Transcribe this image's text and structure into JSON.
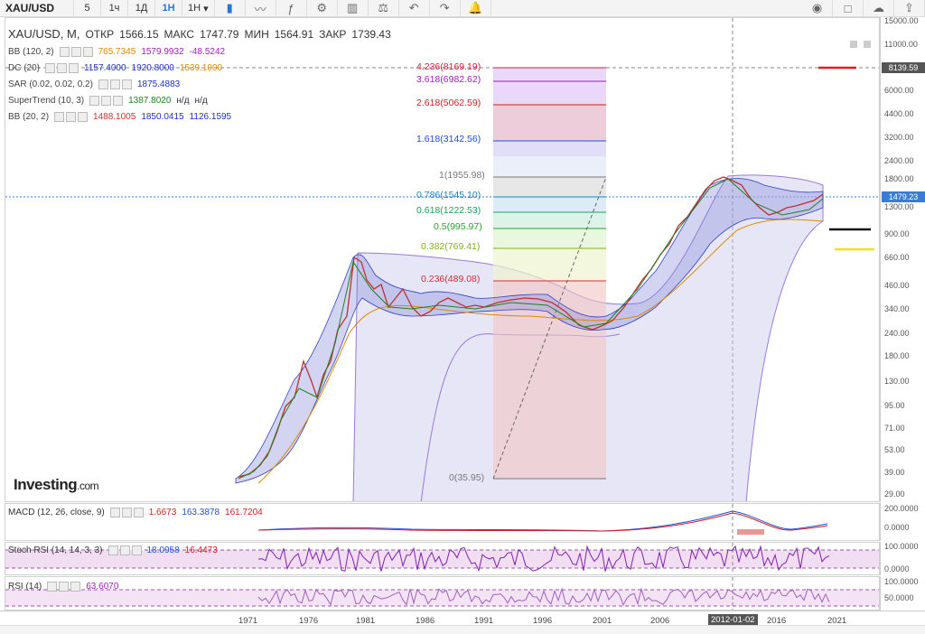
{
  "toolbar": {
    "symbol": "XAU/USD",
    "intervals": [
      "5",
      "1ч",
      "1Д",
      "1Н",
      "1Н"
    ],
    "active_interval_index": 3,
    "icons": [
      "candles-icon",
      "line-chart-icon",
      "indicators-icon",
      "settings-icon",
      "bar-levels-icon",
      "balance-icon",
      "undo-icon",
      "redo-icon",
      "alert-icon",
      "camera-icon",
      "color-square-icon",
      "cloud-icon",
      "cloud-upload-icon"
    ]
  },
  "legend": {
    "title": "XAU/USD, M,",
    "open_label": "ОТКР",
    "open": "1566.15",
    "high_label": "МАКС",
    "high": "1747.79",
    "low_label": "МИН",
    "low": "1564.91",
    "close_label": "ЗАКР",
    "close": "1739.43",
    "indicators": [
      {
        "name": "BB (120, 2)",
        "values": [
          "765.7345",
          "1579.9932",
          "-48.5242"
        ],
        "colors": [
          "#e08a00",
          "#a020c0",
          "#a020c0"
        ]
      },
      {
        "name": "DC (20)",
        "values": [
          "1157.4000",
          "1920.8000",
          "1539.1000"
        ],
        "colors": [
          "#2030c0",
          "#2030c0",
          "#e08a00"
        ]
      },
      {
        "name": "SAR (0.02, 0.02, 0.2)",
        "values": [
          "1875.4883"
        ],
        "colors": [
          "#2030c0"
        ]
      },
      {
        "name": "SuperTrend (10, 3)",
        "values": [
          "1387.8020",
          "н/д",
          "н/д"
        ],
        "colors": [
          "#208020",
          "#333333",
          "#333333"
        ]
      },
      {
        "name": "BB (20, 2)",
        "values": [
          "1488.1005",
          "1850.0415",
          "1126.1595"
        ],
        "colors": [
          "#d03030",
          "#2030c0",
          "#2030c0"
        ]
      }
    ]
  },
  "price_axis": {
    "ticks": [
      "15000.00",
      "11000.00",
      "8139.59",
      "6000.00",
      "4400.00",
      "3200.00",
      "2400.00",
      "1800.00",
      "1479.23",
      "1300.00",
      "900.00",
      "660.00",
      "460.00",
      "340.00",
      "240.00",
      "180.00",
      "130.00",
      "95.00",
      "71.00",
      "53.00",
      "39.00",
      "29.00"
    ],
    "flag_top": "8139.59",
    "flag_last": "1479.23"
  },
  "fibonacci": [
    {
      "label": "4.236(8169.19)",
      "color": "#d02040"
    },
    {
      "label": "3.618(6982.62)",
      "color": "#a020c0"
    },
    {
      "label": "2.618(5062.59)",
      "color": "#d02020"
    },
    {
      "label": "1.618(3142.56)",
      "color": "#2050d0"
    },
    {
      "label": "1(1955.98)",
      "color": "#777777"
    },
    {
      "label": "0.786(1545.10)",
      "color": "#2080c0"
    },
    {
      "label": "0.618(1222.53)",
      "color": "#20a060"
    },
    {
      "label": "0.5(995.97)",
      "color": "#30a030"
    },
    {
      "label": "0.382(769.41)",
      "color": "#80b020"
    },
    {
      "label": "0.236(489.08)",
      "color": "#d03030"
    },
    {
      "label": "0(35.95)",
      "color": "#777777"
    }
  ],
  "macd": {
    "name": "MACD (12, 26, close, 9)",
    "values": [
      "1.6673",
      "163.3878",
      "161.7204"
    ],
    "ticks": [
      "200.0000",
      "0.0000"
    ]
  },
  "stoch": {
    "name": "Stoch RSI (14, 14, 3, 3)",
    "values": [
      "18.0958",
      "16.4473"
    ],
    "ticks": [
      "100.0000",
      "0.0000"
    ]
  },
  "rsi": {
    "name": "RSI (14)",
    "values": [
      "63.6070"
    ],
    "ticks": [
      "100.0000",
      "50.0000"
    ]
  },
  "x_axis": {
    "ticks": [
      "1971",
      "1976",
      "1981",
      "1986",
      "1991",
      "1996",
      "2001",
      "2006",
      "2016",
      "2021"
    ],
    "highlight": "2012-01-02"
  },
  "logo": {
    "main": "Investing",
    "suffix": ".com"
  }
}
